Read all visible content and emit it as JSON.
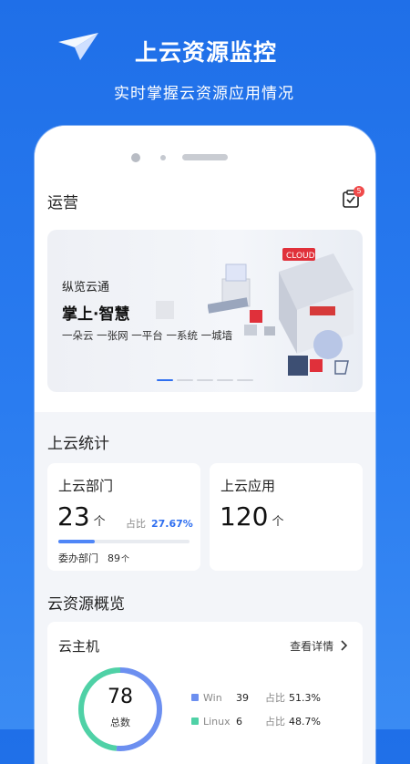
{
  "promo": {
    "title": "上云资源监控",
    "subtitle": "实时掌握云资源应用情况"
  },
  "app": {
    "title": "运营",
    "notification_count": "5"
  },
  "banner": {
    "subtitle": "纵览云通",
    "title": "掌上·智慧",
    "tags": "一朵云 一张网 一平台 一系统 一城墙",
    "active_index": 0,
    "dot_count": 5
  },
  "stats": {
    "section_title": "上云统计",
    "departments": {
      "label": "上云部门",
      "count": "23",
      "unit": "个",
      "ratio_label": "占比",
      "ratio_value": "27.67%",
      "progress": 0.2767,
      "sub_label": "委办部门",
      "sub_count": "89",
      "sub_unit": "个"
    },
    "apps": {
      "label": "上云应用",
      "count": "120",
      "unit": "个"
    }
  },
  "overview": {
    "section_title": "云资源概览",
    "host": {
      "title": "云主机",
      "detail_link": "查看详情",
      "total": "78",
      "total_label": "总数",
      "items": [
        {
          "name": "Win",
          "count": "39",
          "ratio_label": "占比",
          "ratio": "51.3%",
          "color": "#6c8ff0"
        },
        {
          "name": "Linux",
          "count": "6",
          "ratio_label": "占比",
          "ratio": "48.7%",
          "color": "#4fd1a6"
        }
      ]
    }
  },
  "colors": {
    "brand_blue": "#2a7cf0",
    "accent": "#2f6ff0",
    "badge_red": "#f04a4a"
  }
}
